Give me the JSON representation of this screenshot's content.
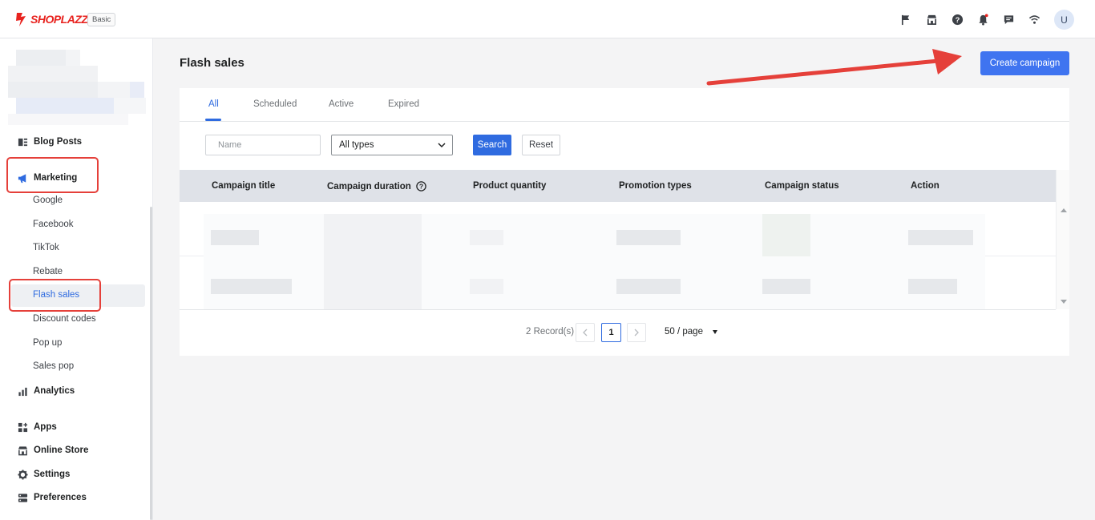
{
  "header": {
    "logo_text": "SHOPLAZZA",
    "plan_badge": "Basic",
    "icons": [
      "flag-icon",
      "store-icon",
      "help-icon",
      "bell-icon",
      "chat-icon",
      "wifi-icon"
    ],
    "avatar_initial": "U"
  },
  "sidebar": {
    "items_top": [
      {
        "label": "Blog Posts",
        "icon": "blog-icon"
      },
      {
        "label": "Marketing",
        "icon": "megaphone-icon"
      }
    ],
    "marketing_sub": [
      "Google",
      "Facebook",
      "TikTok",
      "Rebate",
      "Flash sales",
      "Discount codes",
      "Pop up",
      "Sales pop"
    ],
    "active_sub": "Flash sales",
    "items_bottom": [
      {
        "label": "Analytics",
        "icon": "analytics-icon"
      },
      {
        "label": "Apps",
        "icon": "apps-icon"
      },
      {
        "label": "Online Store",
        "icon": "store-icon"
      },
      {
        "label": "Settings",
        "icon": "gear-icon"
      },
      {
        "label": "Preferences",
        "icon": "preferences-icon"
      }
    ]
  },
  "page": {
    "title": "Flash sales",
    "create_button": "Create campaign",
    "tabs": [
      "All",
      "Scheduled",
      "Active",
      "Expired"
    ],
    "active_tab": "All",
    "filters": {
      "name_placeholder": "Name",
      "type_value": "All types",
      "search_label": "Search",
      "reset_label": "Reset"
    },
    "table": {
      "columns": [
        "Campaign title",
        "Campaign duration",
        "Product quantity",
        "Promotion types",
        "Campaign status",
        "Action"
      ]
    },
    "pagination": {
      "records": "2 Record(s)",
      "current_page": "1",
      "per_page": "50 / page"
    }
  },
  "colors": {
    "accent": "#2f6be0",
    "primary_button": "#3f74f0",
    "brand": "#e8231f",
    "annotation": "#e5403a"
  }
}
